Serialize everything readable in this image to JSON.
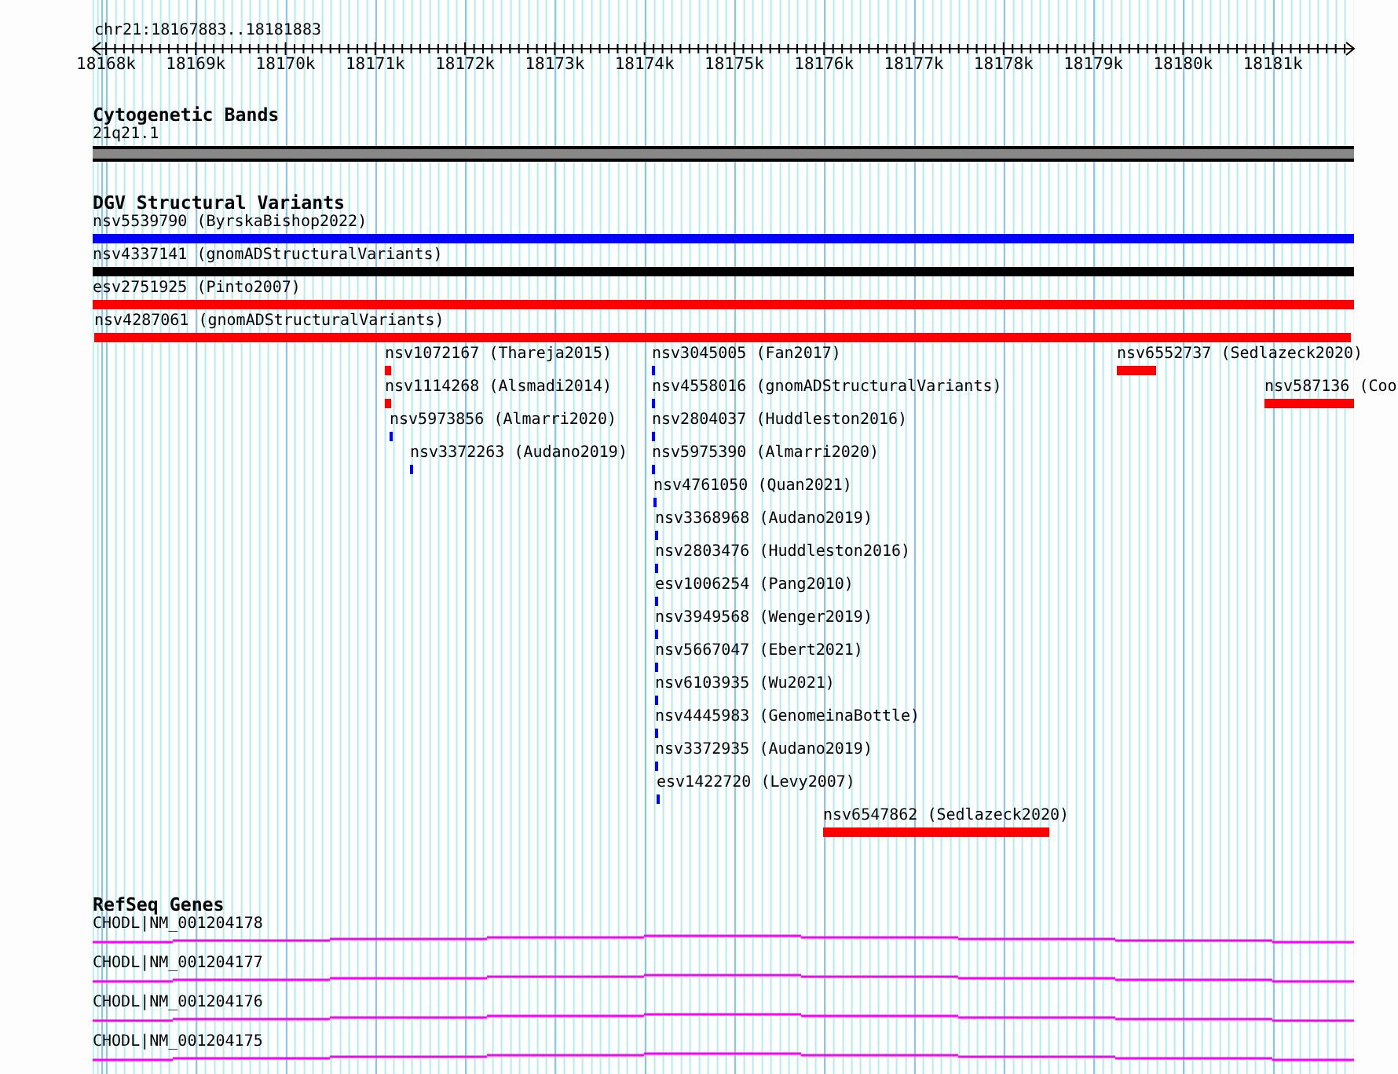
{
  "ruler": {
    "region": "chr21:18167883..18181883",
    "ticks": [
      "18168k",
      "18169k",
      "18170k",
      "18171k",
      "18172k",
      "18173k",
      "18174k",
      "18175k",
      "18176k",
      "18177k",
      "18178k",
      "18179k",
      "18180k",
      "18181k"
    ]
  },
  "tracks": [
    {
      "kind": "cytoband",
      "title": "Cytogenetic Bands",
      "features": [
        {
          "label": "21q21.1"
        }
      ]
    },
    {
      "kind": "variants",
      "title": "DGV Structural Variants",
      "rows": [
        [
          {
            "label": "nsv5539790 (ByrskaBishop2022)",
            "color": "#0000ff"
          }
        ],
        [
          {
            "label": "nsv4337141 (gnomADStructuralVariants)",
            "color": "#000000"
          }
        ],
        [
          {
            "label": "esv2751925 (Pinto2007)",
            "color": "#ff0000"
          }
        ],
        [
          {
            "label": "nsv4287061 (gnomADStructuralVariants)",
            "color": "#ff0000"
          }
        ],
        [
          {
            "label": "nsv1072167 (Thareja2015)",
            "color": "#ff0000"
          },
          {
            "label": "nsv3045005 (Fan2017)",
            "color": "#0000ff"
          },
          {
            "label": "nsv6552737 (Sedlazeck2020)",
            "color": "#ff0000"
          }
        ],
        [
          {
            "label": "nsv1114268 (Alsmadi2014)",
            "color": "#ff0000"
          },
          {
            "label": "nsv4558016 (gnomADStructuralVariants)",
            "color": "#0000ff"
          },
          {
            "label": "nsv587136 (Coo",
            "color": "#ff0000"
          }
        ],
        [
          {
            "label": "nsv5973856 (Almarri2020)",
            "color": "#0000ff"
          },
          {
            "label": "nsv2804037 (Huddleston2016)",
            "color": "#0000ff"
          }
        ],
        [
          {
            "label": "nsv3372263 (Audano2019)",
            "color": "#0000ff"
          },
          {
            "label": "nsv5975390 (Almarri2020)",
            "color": "#0000ff"
          }
        ],
        [
          {
            "label": "nsv4761050 (Quan2021)",
            "color": "#0000ff"
          }
        ],
        [
          {
            "label": "nsv3368968 (Audano2019)",
            "color": "#0000ff"
          }
        ],
        [
          {
            "label": "nsv2803476 (Huddleston2016)",
            "color": "#0000ff"
          }
        ],
        [
          {
            "label": "esv1006254 (Pang2010)",
            "color": "#0000ff"
          }
        ],
        [
          {
            "label": "nsv3949568 (Wenger2019)",
            "color": "#0000ff"
          }
        ],
        [
          {
            "label": "nsv5667047 (Ebert2021)",
            "color": "#0000ff"
          }
        ],
        [
          {
            "label": "nsv6103935 (Wu2021)",
            "color": "#0000ff"
          }
        ],
        [
          {
            "label": "nsv4445983 (GenomeinaBottle)",
            "color": "#0000ff"
          }
        ],
        [
          {
            "label": "nsv3372935 (Audano2019)",
            "color": "#0000ff"
          }
        ],
        [
          {
            "label": "esv1422720 (Levy2007)",
            "color": "#0000ff"
          }
        ],
        [
          {
            "label": "nsv6547862 (Sedlazeck2020)",
            "color": "#ff0000"
          }
        ]
      ]
    },
    {
      "kind": "genes",
      "title": "RefSeq Genes",
      "features": [
        {
          "label": "CHODL|NM_001204178"
        },
        {
          "label": "CHODL|NM_001204177"
        },
        {
          "label": "CHODL|NM_001204176"
        },
        {
          "label": "CHODL|NM_001204175"
        }
      ]
    }
  ]
}
